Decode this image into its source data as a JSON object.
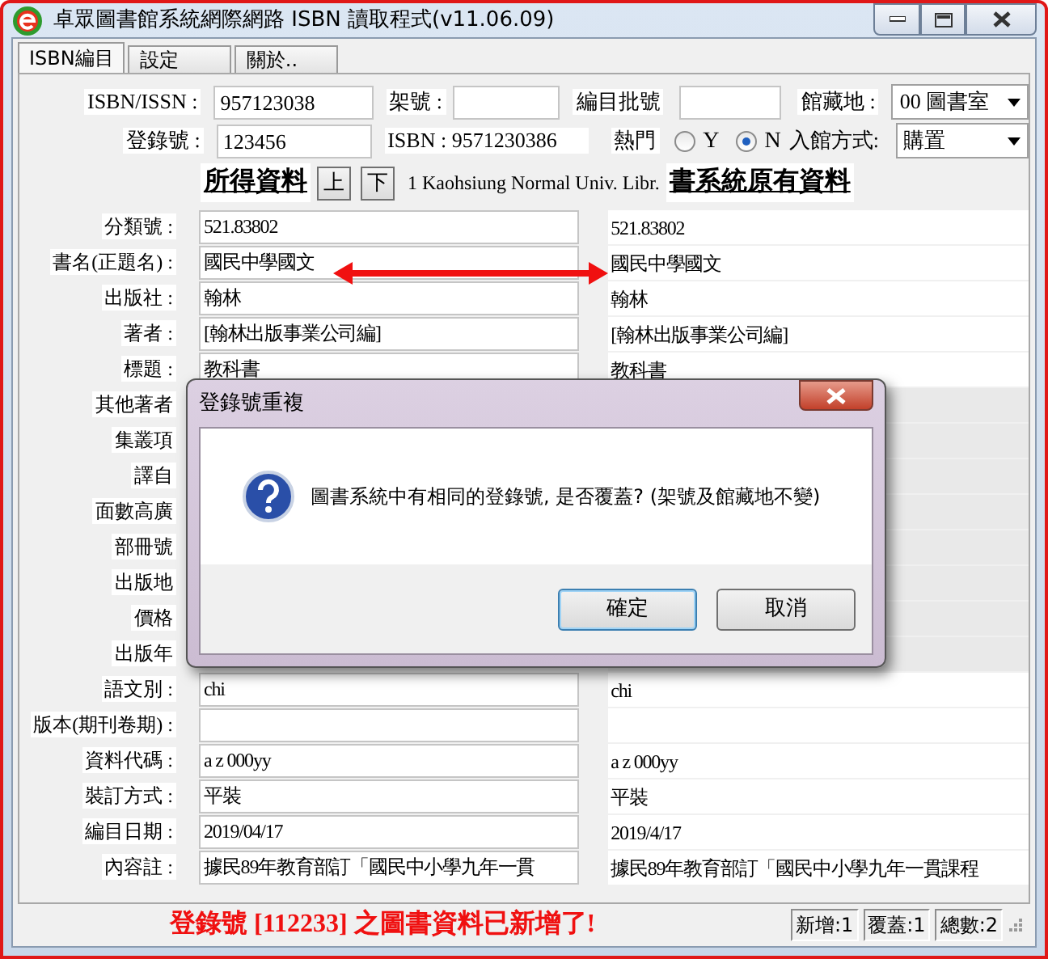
{
  "window": {
    "title": "卓眾圖書館系統網際網路 ISBN 讀取程式(v11.06.09)"
  },
  "tabs": [
    {
      "label": "ISBN編目",
      "selected": true
    },
    {
      "label": "設定",
      "selected": false
    },
    {
      "label": "關於..",
      "selected": false
    }
  ],
  "isbn_issn": {
    "label": "ISBN/ISSN :",
    "value": "957123038"
  },
  "shelf_no": {
    "label": "架號 :"
  },
  "catalog_batch": {
    "label": "編目批號"
  },
  "location": {
    "label": "館藏地 :",
    "value": "00 圖書室"
  },
  "accession_no": {
    "label": "登錄號 :",
    "value": "123456"
  },
  "isbn": {
    "text": "ISBN : 9571230386"
  },
  "popular": {
    "label": "熱門",
    "options": [
      {
        "label": "Y",
        "selected": false
      },
      {
        "label": "N",
        "selected": true
      }
    ]
  },
  "acquisition": {
    "label": "入館方式:",
    "value": "購置"
  },
  "retrieved_heading": "所得資料",
  "nav_buttons": [
    "上",
    "下"
  ],
  "source": "1 Kaohsiung Normal Univ. Libr.",
  "original_heading": "書系統原有資料",
  "fields": [
    {
      "label": "分類號 :",
      "value": "521.83802",
      "original": "521.83802"
    },
    {
      "label": "書名(正題名) :",
      "value": "國民中學國文",
      "original": "國民中學國文"
    },
    {
      "label": "出版社 :",
      "value": "翰林",
      "original": "翰林"
    },
    {
      "label": "著者 :",
      "value": "[翰林出版事業公司編]",
      "original": "[翰林出版事業公司編]"
    },
    {
      "label": "標題 :",
      "value": "教科書",
      "original": "教科書"
    },
    {
      "label": "其他著者",
      "kind": "covered"
    },
    {
      "label": "集叢項",
      "kind": "covered"
    },
    {
      "label": "譯自",
      "kind": "covered"
    },
    {
      "label": "面數高廣",
      "kind": "covered"
    },
    {
      "label": "部冊號",
      "kind": "covered"
    },
    {
      "label": "出版地",
      "kind": "covered"
    },
    {
      "label": "價格",
      "kind": "covered"
    },
    {
      "label": "出版年",
      "kind": "covered"
    },
    {
      "label": "語文別 :",
      "value": "chi",
      "original": "chi"
    },
    {
      "label": "版本(期刊卷期) :"
    },
    {
      "label": "資料代碼 :",
      "value": "a  z  000yy",
      "original": "a  z  000yy"
    },
    {
      "label": "裝訂方式 :",
      "value": "平裝",
      "original": "平裝"
    },
    {
      "label": "編目日期 :",
      "value": "2019/04/17",
      "original": "2019/4/17"
    },
    {
      "label": "內容註 :",
      "value": "據民89年教育部訂「國民中小學九年一貫",
      "original": "據民89年教育部訂「國民中小學九年一貫課程"
    }
  ],
  "dialog": {
    "title": "登錄號重複",
    "message": "圖書系統中有相同的登錄號, 是否覆蓋? (架號及館藏地不變)",
    "buttons": [
      {
        "label": "確定",
        "default": true
      },
      {
        "label": "取消",
        "default": false
      }
    ]
  },
  "status": {
    "message": "登錄號 [112233] 之圖書資料已新增了!",
    "counters": [
      "新增:1",
      "覆蓋:1",
      "總數:2"
    ]
  }
}
